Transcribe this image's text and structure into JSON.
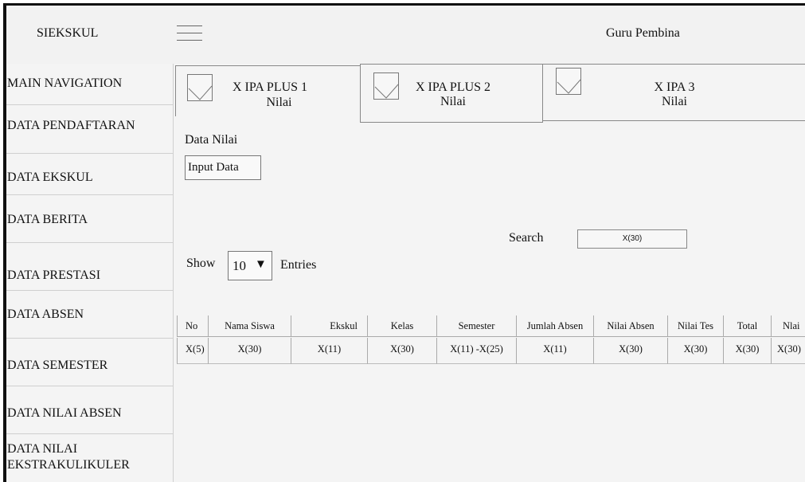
{
  "topbar": {
    "brand": "SIEKSKUL",
    "menu_icon": "hamburger-icon",
    "user": "Guru Pembina"
  },
  "sidebar": {
    "heading": "MAIN NAVIGATION",
    "items": [
      "DATA PENDAFTARAN",
      "DATA EKSKUL",
      "DATA BERITA",
      "DATA PRESTASI",
      "DATA ABSEN",
      "DATA SEMESTER",
      "DATA NILAI ABSEN",
      "DATA NILAI",
      "EKSTRAKULIKULER"
    ]
  },
  "tabs": [
    {
      "title": "X IPA PLUS 1",
      "subtitle": "Nilai"
    },
    {
      "title": "X IPA PLUS 2",
      "subtitle": "Nilai"
    },
    {
      "title": "X IPA 3",
      "subtitle": "Nilai"
    }
  ],
  "content": {
    "heading": "Data Nilai",
    "input_button": "Input Data",
    "search_label": "Search",
    "search_value": "X(30)",
    "show_label": "Show",
    "entries_value": "10",
    "entries_label": "Entries"
  },
  "table": {
    "headers": [
      "No",
      "Nama Siswa",
      "Ekskul",
      "Kelas",
      "Semester",
      "Jumlah Absen",
      "Nilai Absen",
      "Nilai Tes",
      "Total",
      "Nlai"
    ],
    "rows": [
      [
        "X(5)",
        "X(30)",
        "X(11)",
        "X(30)",
        "X(11) -X(25)",
        "X(11)",
        "X(30)",
        "X(30)",
        "X(30)",
        "X(30)"
      ]
    ]
  }
}
